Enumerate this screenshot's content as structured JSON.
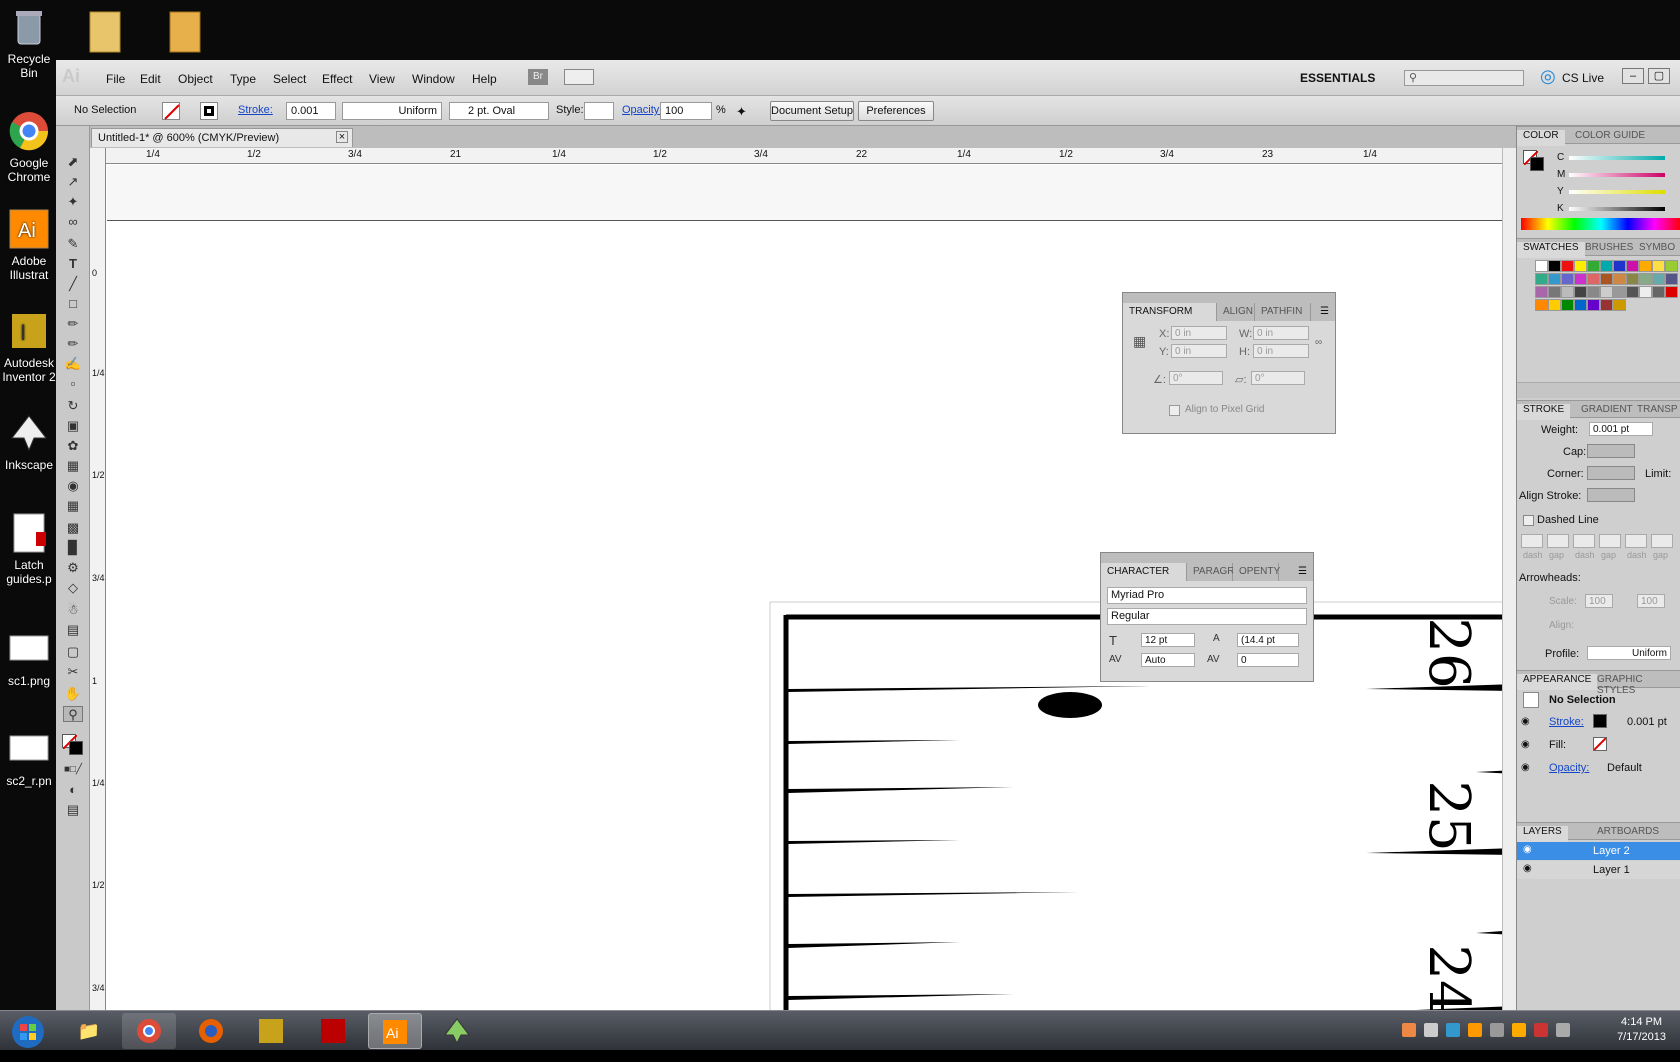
{
  "desktop": {
    "icons": [
      {
        "label": "Recycle Bin",
        "icon": "recycle-bin-icon"
      },
      {
        "label": "Google Chrome",
        "icon": "chrome-icon"
      },
      {
        "label": "Adobe Illustrat",
        "icon": "illustrator-icon"
      },
      {
        "label": "Autodesk Inventor 2",
        "icon": "inventor-icon"
      },
      {
        "label": "Inkscape",
        "icon": "inkscape-icon"
      },
      {
        "label": "Latch guides.p",
        "icon": "pdf-file-icon"
      },
      {
        "label": "sc1.png",
        "icon": "image-file-icon"
      },
      {
        "label": "sc2_r.pn",
        "icon": "image-file-icon"
      }
    ]
  },
  "menubar": {
    "logo": "Ai",
    "items": [
      "File",
      "Edit",
      "Object",
      "Type",
      "Select",
      "Effect",
      "View",
      "Window",
      "Help"
    ],
    "bridge": "Br",
    "workspace": "ESSENTIALS",
    "cs_live": "CS Live"
  },
  "control": {
    "selection": "No Selection",
    "stroke_label": "Stroke:",
    "stroke_value": "0.001",
    "profile": "Uniform",
    "brush": "2 pt. Oval",
    "style_label": "Style:",
    "opacity_label": "Opacity:",
    "opacity_value": "100",
    "opacity_unit": "%",
    "doc_setup": "Document Setup",
    "preferences": "Preferences"
  },
  "document": {
    "tab_title": "Untitled-1* @ 600% (CMYK/Preview)"
  },
  "ruler": {
    "top": [
      "1/4",
      "1/2",
      "3/4",
      "21",
      "1/4",
      "1/2",
      "3/4",
      "22",
      "1/4",
      "1/2",
      "3/4",
      "23",
      "1/4"
    ],
    "left": [
      "0",
      "1/4",
      "1/2",
      "3/4",
      "1",
      "1/4",
      "1/2",
      "3/4"
    ]
  },
  "transform": {
    "tabs": [
      "TRANSFORM",
      "ALIGN",
      "PATHFIN"
    ],
    "x": "0 in",
    "y": "0 in",
    "w": "0 in",
    "h": "0 in",
    "x_label": "X:",
    "y_label": "Y:",
    "w_label": "W:",
    "h_label": "H:",
    "angle": "0°",
    "shear": "0°",
    "align_pixel": "Align to Pixel Grid"
  },
  "character": {
    "tabs": [
      "CHARACTER",
      "PARAGR",
      "OPENTY"
    ],
    "font": "Myriad Pro",
    "style": "Regular",
    "size": "12 pt",
    "leading": "(14.4 pt",
    "kerning": "Auto",
    "tracking": "0"
  },
  "artwork": {
    "numbers": [
      "26",
      "25",
      "24"
    ]
  },
  "right_dock": {
    "color_tabs": [
      "COLOR",
      "COLOR GUIDE"
    ],
    "cmyk": [
      "C",
      "M",
      "Y",
      "K"
    ],
    "swatch_tabs": [
      "SWATCHES",
      "BRUSHES",
      "SYMBO"
    ],
    "stroke_tabs": [
      "STROKE",
      "GRADIENT",
      "TRANSP"
    ],
    "weight_label": "Weight:",
    "weight_value": "0.001 pt",
    "cap_label": "Cap:",
    "corner_label": "Corner:",
    "limit_label": "Limit:",
    "align_stroke_label": "Align Stroke:",
    "dashed_line": "Dashed Line",
    "dash_labels": [
      "dash",
      "gap",
      "dash",
      "gap",
      "dash",
      "gap"
    ],
    "arrowheads": "Arrowheads:",
    "scale_label": "Scale:",
    "scale1": "100",
    "scale2": "100",
    "align_label": "Align:",
    "profile_label": "Profile:",
    "profile_value": "Uniform",
    "appearance_tabs": [
      "APPEARANCE",
      "GRAPHIC STYLES"
    ],
    "app_title": "No Selection",
    "app_stroke": "Stroke:",
    "app_stroke_val": "0.001 pt",
    "app_fill": "Fill:",
    "app_opacity": "Opacity:",
    "app_opacity_val": "Default",
    "layer_tabs": [
      "LAYERS",
      "ARTBOARDS"
    ],
    "layers": [
      "Layer 2",
      "Layer 1"
    ]
  },
  "taskbar": {
    "time": "4:14 PM",
    "date": "7/17/2013"
  },
  "colors": {
    "accent": "#1646c8",
    "layer_selected": "#3a8ee6"
  }
}
